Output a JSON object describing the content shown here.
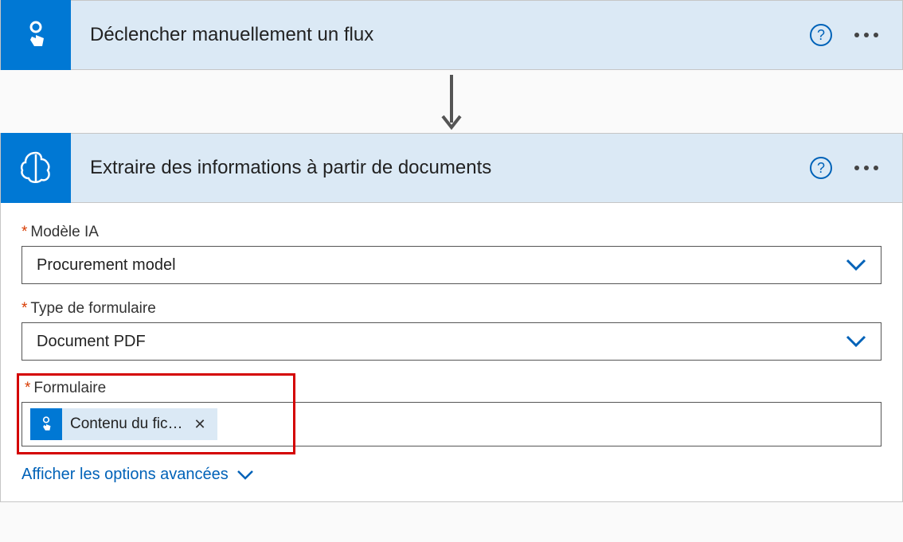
{
  "trigger": {
    "title": "Déclencher manuellement un flux"
  },
  "action": {
    "title": "Extraire des informations à partir de documents",
    "fields": {
      "model": {
        "label": "Modèle IA",
        "value": "Procurement model"
      },
      "formType": {
        "label": "Type de formulaire",
        "value": "Document PDF"
      },
      "form": {
        "label": "Formulaire",
        "tokenLabel": "Contenu du fic…"
      }
    },
    "advancedLink": "Afficher les options avancées"
  },
  "helpGlyph": "?"
}
